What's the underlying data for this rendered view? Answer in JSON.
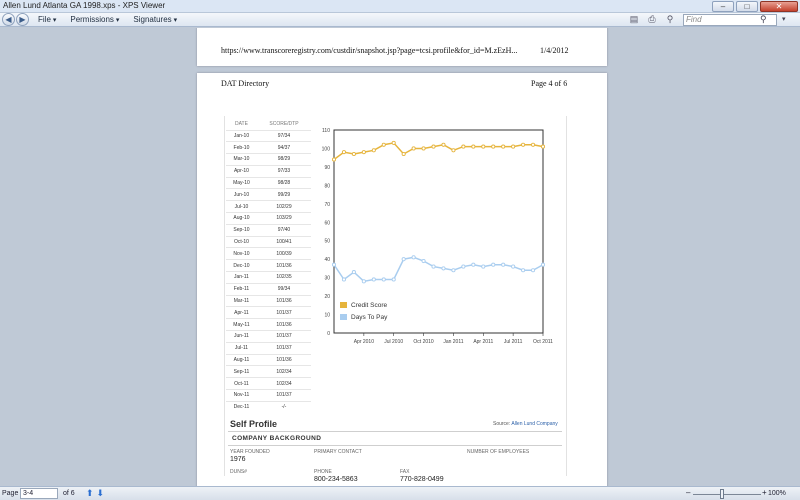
{
  "window": {
    "title": "Allen Lund Atlanta GA 1998.xps - XPS Viewer",
    "controls": {
      "minimize": "–",
      "maximize": "□",
      "close": "✕"
    }
  },
  "toolbar": {
    "menus": [
      "File",
      "Permissions",
      "Signatures"
    ],
    "find_placeholder": "Find"
  },
  "page_prev": {
    "url": "https://www.transcoreregistry.com/custdir/snapshot.jsp?page=tcsi.profile&for_id=M.zEzH...",
    "date": "1/4/2012"
  },
  "page_current": {
    "header_left": "DAT Directory",
    "header_right": "Page 4 of 6"
  },
  "table": {
    "headers": [
      "DATE",
      "SCORE/DTP"
    ],
    "rows": [
      [
        "Jan-10",
        "97/34"
      ],
      [
        "Feb-10",
        "94/37"
      ],
      [
        "Mar-10",
        "98/29"
      ],
      [
        "Apr-10",
        "97/33"
      ],
      [
        "May-10",
        "98/28"
      ],
      [
        "Jun-10",
        "99/29"
      ],
      [
        "Jul-10",
        "102/29"
      ],
      [
        "Aug-10",
        "103/29"
      ],
      [
        "Sep-10",
        "97/40"
      ],
      [
        "Oct-10",
        "100/41"
      ],
      [
        "Nov-10",
        "100/39"
      ],
      [
        "Dec-10",
        "101/36"
      ],
      [
        "Jan-11",
        "102/35"
      ],
      [
        "Feb-11",
        "99/34"
      ],
      [
        "Mar-11",
        "101/36"
      ],
      [
        "Apr-11",
        "101/37"
      ],
      [
        "May-11",
        "101/36"
      ],
      [
        "Jun-11",
        "101/37"
      ],
      [
        "Jul-11",
        "101/37"
      ],
      [
        "Aug-11",
        "101/36"
      ],
      [
        "Sep-11",
        "102/34"
      ],
      [
        "Oct-11",
        "102/34"
      ],
      [
        "Nov-11",
        "101/37"
      ],
      [
        "Dec-11",
        "-/-"
      ]
    ]
  },
  "chart_data": {
    "type": "line",
    "ylim": [
      0,
      110
    ],
    "yticks": [
      0,
      10,
      20,
      30,
      40,
      50,
      60,
      70,
      80,
      90,
      100,
      110
    ],
    "xtick_labels": [
      "Apr 2010",
      "Jul 2010",
      "Oct 2010",
      "Jan 2011",
      "Apr 2011",
      "Jul 2011",
      "Oct 2011"
    ],
    "xtick_index": [
      3,
      6,
      9,
      12,
      15,
      18,
      21
    ],
    "series": [
      {
        "name": "Credit Score",
        "color": "#e6b43c",
        "values": [
          94,
          98,
          97,
          98,
          99,
          102,
          103,
          97,
          100,
          100,
          101,
          102,
          99,
          101,
          101,
          101,
          101,
          101,
          101,
          102,
          102,
          101
        ]
      },
      {
        "name": "Days To Pay",
        "color": "#a9cdef",
        "values": [
          37,
          29,
          33,
          28,
          29,
          29,
          29,
          40,
          41,
          39,
          36,
          35,
          34,
          36,
          37,
          36,
          37,
          37,
          36,
          34,
          34,
          37
        ]
      }
    ],
    "grid": false,
    "legend": "bottom-left"
  },
  "profile": {
    "title": "Self Profile",
    "source_label": "Source:",
    "source_link": "Allen Lund Company",
    "section_title": "COMPANY BACKGROUND",
    "year_founded_label": "YEAR FOUNDED",
    "year_founded": "1976",
    "primary_contact_label": "PRIMARY CONTACT",
    "employees_label": "NUMBER OF EMPLOYEES",
    "duns_label": "DUNS#",
    "phone_label": "PHONE",
    "phone": "800-234-5863",
    "fax_label": "FAX",
    "fax": "770-828-0499"
  },
  "status": {
    "page_label": "Page",
    "page_value": "3-4",
    "of_label": "of 6",
    "zoom": "100%",
    "zoom_fraction": 0.43
  }
}
